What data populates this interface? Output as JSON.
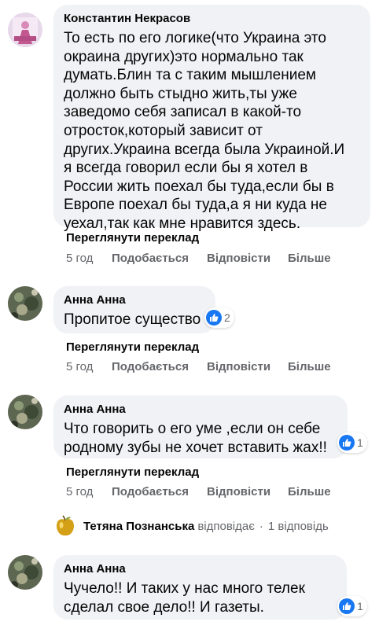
{
  "comments": [
    {
      "author": "Константин Некрасов",
      "lines": [
        "То есть по его логике(что Украина это",
        "окраина других)это нормально так",
        "думать.Блин та с таким мышлением",
        "должно быть стыдно жить,ты уже",
        "заведомо себя записал в какой-то",
        "отросток,который зависит от",
        "других.Украина всегда была Украиной.И",
        "я всегда говорил если бы я хотел в",
        "России жить поехал бы туда,если бы в",
        "Европе поехал бы туда,а я ни куда не",
        "уехал,так как мне нравится здесь."
      ],
      "translate": "Переглянути переклад",
      "time": "5 год",
      "like": "Подобається",
      "reply": "Відповісти",
      "more": "Більше"
    },
    {
      "author": "Анна Анна",
      "lines": [
        "Пропитое существо"
      ],
      "reaction_icon": "like-icon",
      "reactions": "2",
      "translate": "Переглянути переклад",
      "time": "5 год",
      "like": "Подобається",
      "reply": "Відповісти",
      "more": "Більше"
    },
    {
      "author": "Анна Анна",
      "lines": [
        "Что говорить о его уме ,если он себе",
        "родному зубы не хочет вставить жах!!"
      ],
      "reaction_icon": "like-icon",
      "reactions": "1",
      "translate": "Переглянути переклад",
      "time": "5 год",
      "like": "Подобається",
      "reply": "Відповісти",
      "more": "Більше"
    },
    {
      "author": "Анна Анна",
      "lines": [
        "Чучело!! И таких у нас много телек",
        "сделал свое дело!! И газеты."
      ],
      "reaction_icon": "like-icon",
      "reactions": "1"
    }
  ],
  "reply_summary": {
    "name": "Тетяна Познанська",
    "verb": "відповідає",
    "separator": "·",
    "count": "1 відповідь"
  },
  "colors": {
    "bubble": "#f0f2f5",
    "secondary_text": "#65676b",
    "like_blue": "#1877f2"
  }
}
